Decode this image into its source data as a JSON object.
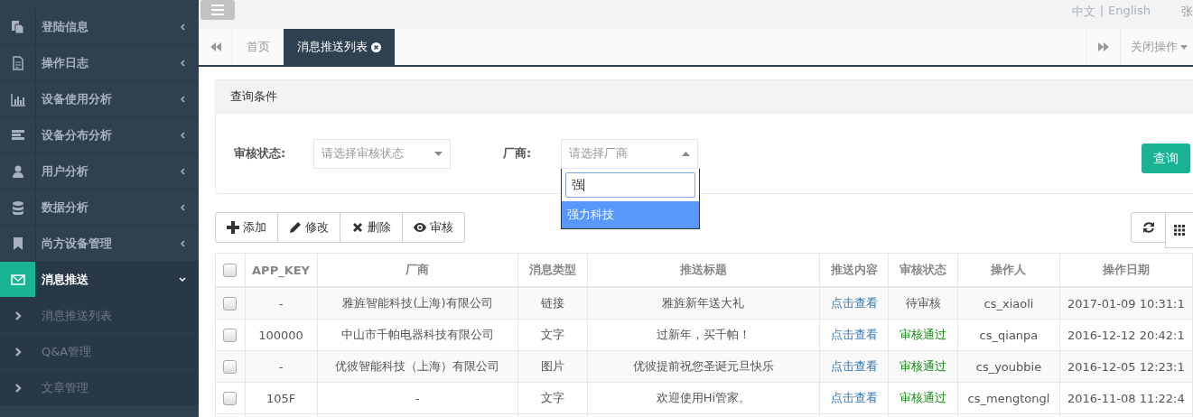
{
  "sidebar": {
    "items": [
      {
        "label": "登陆信息",
        "selected": false,
        "expanded": false
      },
      {
        "label": "操作日志",
        "selected": false,
        "expanded": false
      },
      {
        "label": "设备使用分析",
        "selected": false,
        "expanded": false
      },
      {
        "label": "设备分布分析",
        "selected": false,
        "expanded": false
      },
      {
        "label": "用户分析",
        "selected": false,
        "expanded": false
      },
      {
        "label": "数据分析",
        "selected": false,
        "expanded": false
      },
      {
        "label": "尚方设备管理",
        "selected": false,
        "expanded": false
      },
      {
        "label": "消息推送",
        "selected": true,
        "expanded": true,
        "children": [
          {
            "label": "消息推送列表"
          },
          {
            "label": "Q&A管理"
          },
          {
            "label": "文章管理"
          }
        ]
      }
    ]
  },
  "topbar": {
    "languages": [
      "中文",
      "English"
    ],
    "separator": "|",
    "user": "张"
  },
  "tabs": [
    {
      "label": "首页",
      "selected": false,
      "closable": false
    },
    {
      "label": "消息推送列表",
      "selected": true,
      "closable": true
    }
  ],
  "tab_actions": {
    "close_menu": "关闭操作"
  },
  "query_panel": {
    "title": "查询条件",
    "fields": [
      {
        "label": "审核状态:",
        "placeholder": "请选择审核状态",
        "open": false
      },
      {
        "label": "厂商:",
        "placeholder": "请选择厂商",
        "open": true,
        "search": "强",
        "options": [
          {
            "label": "强力科技",
            "selected": true
          }
        ]
      }
    ],
    "submit": "查询"
  },
  "toolbar": {
    "buttons": [
      "添加",
      "修改",
      "删除",
      "审核"
    ]
  },
  "table": {
    "select_all_checked": false,
    "columns": [
      "APP_KEY",
      "厂商",
      "消息类型",
      "推送标题",
      "推送内容",
      "审核状态",
      "操作人",
      "操作日期"
    ],
    "rows": [
      {
        "checked": false,
        "app_key": "-",
        "vendor": "雅旌智能科技(上海)有限公司",
        "type": "链接",
        "title": "雅旌新年送大礼",
        "content": "点击查看",
        "status": "待审核",
        "approved": false,
        "operator": "cs_xiaoli",
        "date": "2017-01-09 10:31:1"
      },
      {
        "checked": false,
        "app_key": "100000",
        "vendor": "中山市千帕电器科技有限公司",
        "type": "文字",
        "title": "过新年，买千帕！",
        "content": "点击查看",
        "status": "审核通过",
        "approved": true,
        "operator": "cs_qianpa",
        "date": "2016-12-12 20:42:1"
      },
      {
        "checked": false,
        "app_key": "-",
        "vendor": "优彼智能科技（上海）有限公司",
        "type": "图片",
        "title": "优彼提前祝您圣诞元旦快乐",
        "content": "点击查看",
        "status": "审核通过",
        "approved": true,
        "operator": "cs_youbbie",
        "date": "2016-12-05 12:23:1"
      },
      {
        "checked": false,
        "app_key": "105F",
        "vendor": "-",
        "type": "文字",
        "title": "欢迎使用Hi管家。",
        "content": "点击查看",
        "status": "审核通过",
        "approved": true,
        "operator": "cs_mengtongl",
        "date": "2016-11-08 11:22:4"
      }
    ]
  }
}
